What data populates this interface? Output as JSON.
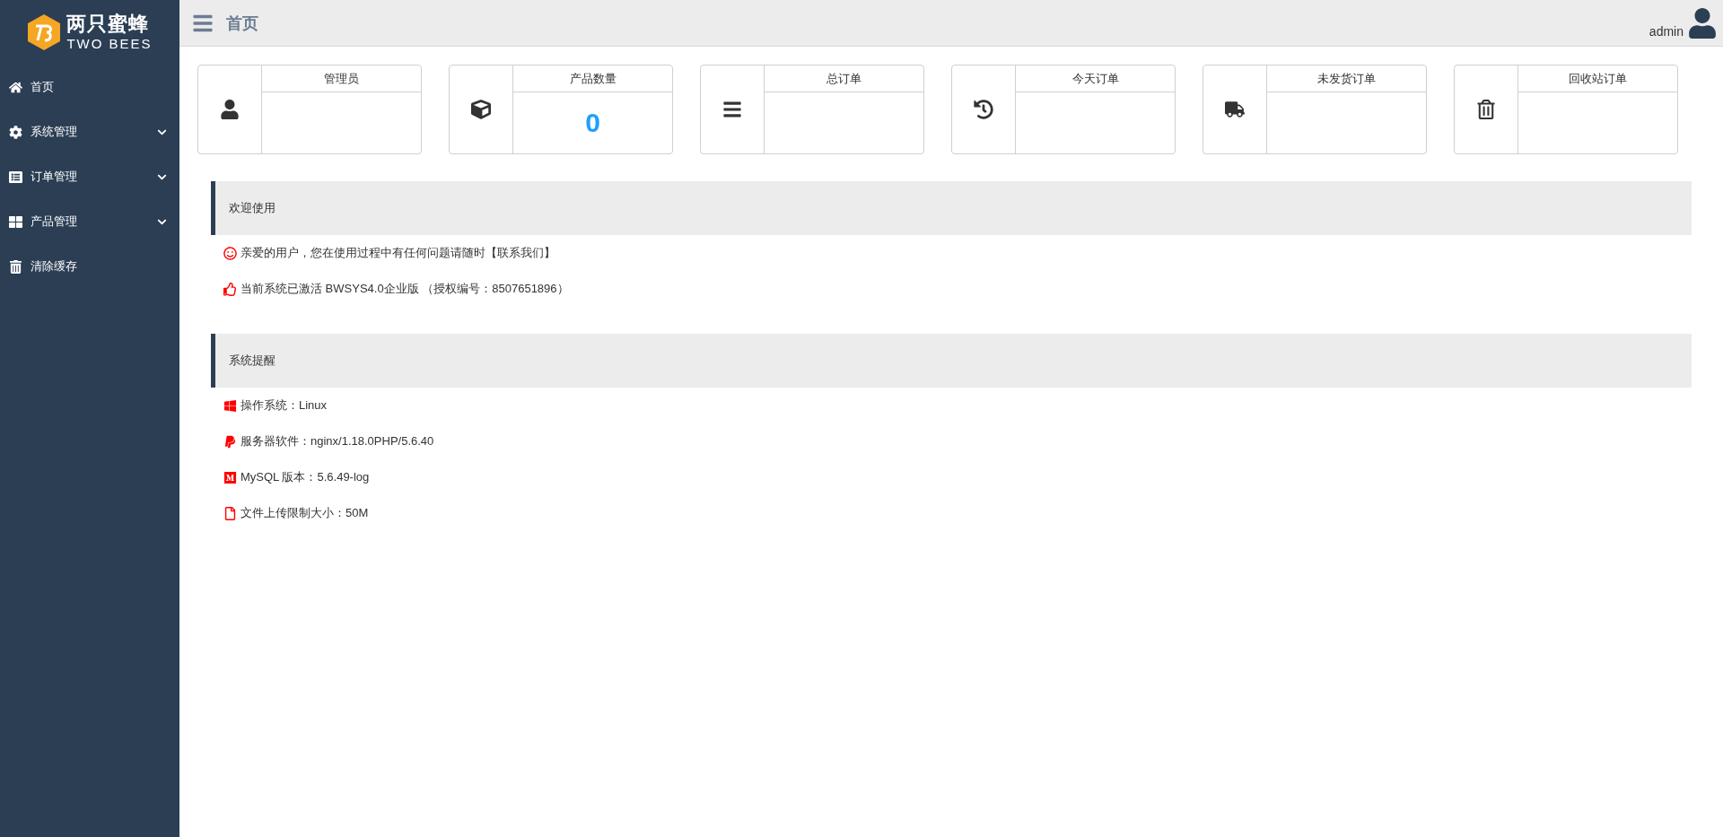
{
  "logo": {
    "name": "两只蜜蜂",
    "subtitle": "TWO BEES"
  },
  "sidebar": {
    "items": [
      {
        "label": "首页",
        "kind": "link"
      },
      {
        "label": "系统管理",
        "kind": "group"
      },
      {
        "label": "订单管理",
        "kind": "group"
      },
      {
        "label": "产品管理",
        "kind": "group"
      },
      {
        "label": "清除缓存",
        "kind": "link"
      }
    ]
  },
  "header": {
    "title": "首页",
    "user": "admin"
  },
  "cards": [
    {
      "title": "管理员"
    },
    {
      "title": "产品数量",
      "value": "0"
    },
    {
      "title": "总订单"
    },
    {
      "title": "今天订单"
    },
    {
      "title": "未发货订单"
    },
    {
      "title": "回收站订单"
    }
  ],
  "sections": [
    {
      "title": "欢迎使用",
      "lines": [
        "亲爱的用户，您在使用过程中有任何问题请随时【联系我们】",
        "当前系统已激活 BWSYS4.0企业版 （授权编号：8507651896）"
      ]
    },
    {
      "title": "系统提醒",
      "lines": [
        "操作系统：Linux",
        "服务器软件：nginx/1.18.0PHP/5.6.40",
        "MySQL 版本：5.6.49-log",
        "文件上传限制大小：50M"
      ]
    }
  ]
}
